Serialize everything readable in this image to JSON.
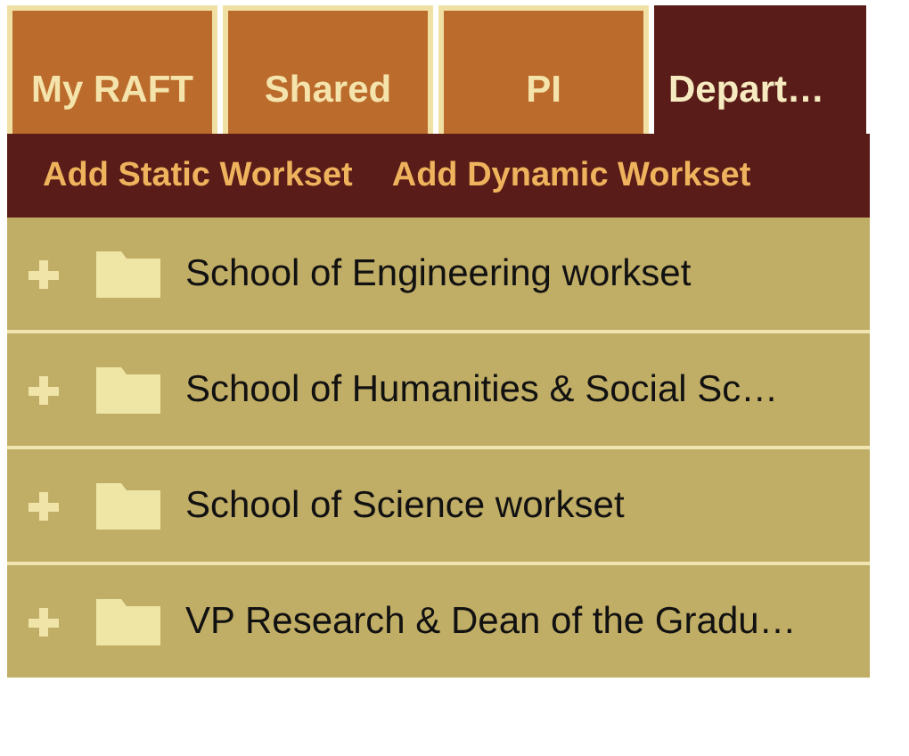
{
  "tabs": [
    {
      "label": "My RAFT",
      "selected": false
    },
    {
      "label": "Shared",
      "selected": false
    },
    {
      "label": "PI",
      "selected": false
    },
    {
      "label": "Depart…",
      "selected": true
    }
  ],
  "toolbar": {
    "buttons": [
      "Add Static Workset",
      "Add Dynamic Workset"
    ]
  },
  "tree": {
    "items": [
      {
        "label": "School of Engineering workset",
        "expanded": false
      },
      {
        "label": "School of Humanities & Social Sc…",
        "expanded": false
      },
      {
        "label": "School of Science workset",
        "expanded": false
      },
      {
        "label": "VP Research & Dean of the Gradu…",
        "expanded": false
      }
    ]
  }
}
